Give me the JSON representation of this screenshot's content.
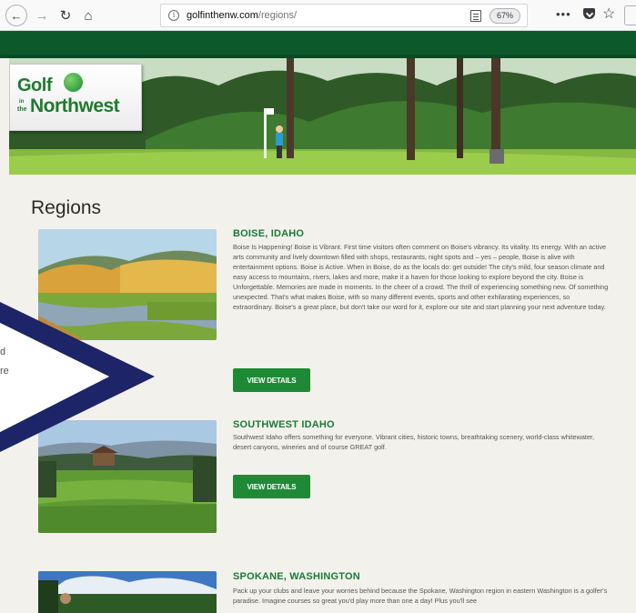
{
  "browser": {
    "url_domain": "golfinthenw.com",
    "url_path": "/regions/",
    "zoom": "67%",
    "info_glyph": "i",
    "back_glyph": "←",
    "forward_glyph": "→",
    "reload_glyph": "↻",
    "home_glyph": "⌂",
    "more_glyph": "•••",
    "star_glyph": "☆"
  },
  "logo": {
    "line1": "Golf",
    "in": "in",
    "the": "the",
    "line2": "Northwest"
  },
  "page": {
    "heading": "Regions"
  },
  "regions": [
    {
      "title": "BOISE, IDAHO",
      "description": "Boise Is Happening! Boise is Vibrant. First time visitors often comment on Boise's vibrancy. Its vitality. Its energy. With an active arts community and lively downtown filled with shops, restaurants, night spots and – yes – people, Boise is alive with entertainment options. Boise is Active. When in Boise, do as the locals do: get outside! The city's mild, four season climate and easy access to mountains, rivers, lakes and more, make it a haven for those looking to explore beyond the city. Boise is Unforgettable. Memories are made in moments. In the cheer of a crowd. The thrill of experiencing something new. Of something unexpected. That's what makes Boise, with so many different events, sports and other exhilarating experiences, so extraordinary. Boise's a great place, but don't take our word for it, explore our site and start planning your next adventure today.",
      "button": "VIEW DETAILS"
    },
    {
      "title": "SOUTHWEST IDAHO",
      "description": "Southwest Idaho offers something for everyone. Vibrant cities, historic towns, breathtaking scenery, world-class whitewater, desert canyons, wineries and of course GREAT golf.",
      "button": "VIEW DETAILS"
    },
    {
      "title": "SPOKANE, WASHINGTON",
      "description": "Pack up your clubs and leave your worries behind because the Spokane, Washington region in eastern Washington is a golfer's paradise. Imagine courses so great you'd play more than one a day! Plus you'll see"
    }
  ],
  "overlay": {
    "text1": "d",
    "text2": "re",
    "color": "#1d2467"
  },
  "colors": {
    "brand_green": "#0c5a2c",
    "title_green": "#1a7a38",
    "button_green": "#1e8a35"
  }
}
